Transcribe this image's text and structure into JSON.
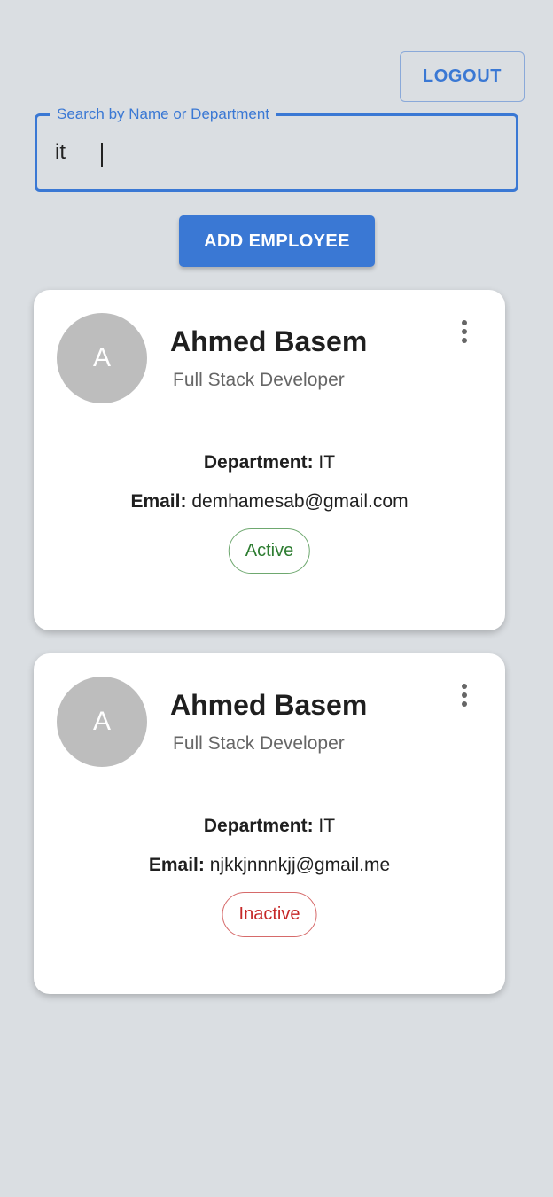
{
  "header": {
    "logout_label": "LOGOUT"
  },
  "search": {
    "label": "Search by Name or Department",
    "value": "it"
  },
  "actions": {
    "add_employee_label": "ADD EMPLOYEE"
  },
  "labels": {
    "department": "Department:",
    "email": "Email:"
  },
  "icons": {
    "card_menu": "more-vertical-icon"
  },
  "colors": {
    "accent": "#3a78d4",
    "active": "#2e7d32",
    "inactive": "#c62828",
    "background": "#dadee2"
  },
  "employees": [
    {
      "avatar_letter": "A",
      "name": "Ahmed Basem",
      "role": "Full Stack Developer",
      "department": "IT",
      "email": "demhamesab@gmail.com",
      "status": "Active"
    },
    {
      "avatar_letter": "A",
      "name": "Ahmed Basem",
      "role": "Full Stack Developer",
      "department": "IT",
      "email": "njkkjnnnkjj@gmail.me",
      "status": "Inactive"
    }
  ]
}
